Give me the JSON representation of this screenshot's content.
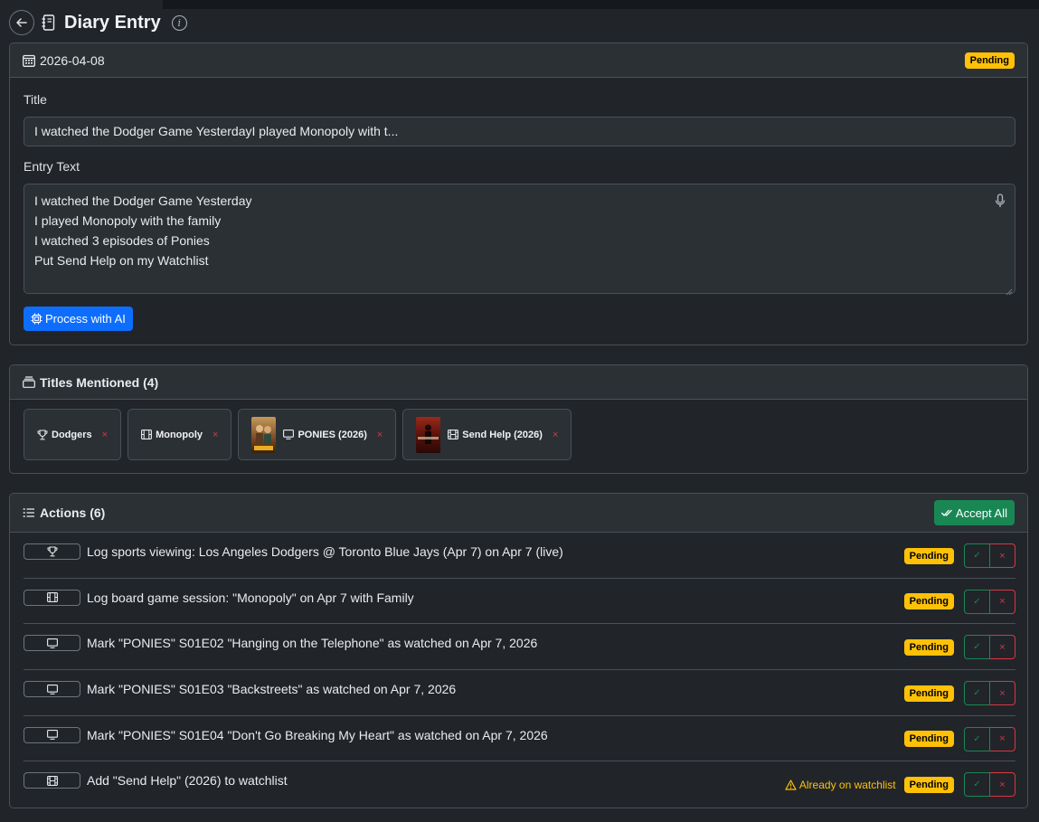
{
  "header": {
    "title": "Diary Entry",
    "back_icon": "arrow-left-icon",
    "journal_icon": "journal-icon",
    "info_icon": "info-icon"
  },
  "diary": {
    "date": "2026-04-08",
    "status": "Pending",
    "title_label": "Title",
    "title_value": "I watched the Dodger Game YesterdayI played Monopoly with t...",
    "entry_label": "Entry Text",
    "entry_lines": [
      "I watched the Dodger Game Yesterday",
      "I played Monopoly with the family",
      "I watched 3 episodes of Ponies",
      "Put Send Help on my Watchlist"
    ],
    "process_label": "Process with AI"
  },
  "titles": {
    "heading": "Titles Mentioned (4)",
    "chips": [
      {
        "label": "Dodgers",
        "icon": "trophy-icon",
        "remove": "×"
      },
      {
        "label": "Monopoly",
        "icon": "board-game-icon",
        "remove": "×"
      },
      {
        "label": "PONIES (2026)",
        "icon": "tv-icon",
        "remove": "×",
        "poster_color": "#8a5a2a"
      },
      {
        "label": "Send Help (2026)",
        "icon": "film-icon",
        "remove": "×",
        "poster_color": "#7a1a14"
      }
    ]
  },
  "actions": {
    "heading": "Actions (6)",
    "accept_all_label": "Accept All",
    "items": [
      {
        "icon": "trophy-icon",
        "text": "Log sports viewing: Los Angeles Dodgers @ Toronto Blue Jays (Apr 7) on Apr 7 (live)",
        "status": "Pending",
        "warning": ""
      },
      {
        "icon": "board-game-icon",
        "text": "Log board game session: \"Monopoly\" on Apr 7 with Family",
        "status": "Pending",
        "warning": ""
      },
      {
        "icon": "tv-icon",
        "text": "Mark \"PONIES\" S01E02 \"Hanging on the Telephone\" as watched on Apr 7, 2026",
        "status": "Pending",
        "warning": ""
      },
      {
        "icon": "tv-icon",
        "text": "Mark \"PONIES\" S01E03 \"Backstreets\" as watched on Apr 7, 2026",
        "status": "Pending",
        "warning": ""
      },
      {
        "icon": "tv-icon",
        "text": "Mark \"PONIES\" S01E04 \"Don't Go Breaking My Heart\" as watched on Apr 7, 2026",
        "status": "Pending",
        "warning": ""
      },
      {
        "icon": "film-icon",
        "text": "Add \"Send Help\" (2026) to watchlist",
        "status": "Pending",
        "warning": "Already on watchlist"
      }
    ],
    "accept_glyph": "✓",
    "reject_glyph": "×"
  },
  "colors": {
    "accent_blue": "#0d6efd",
    "success_green": "#198754",
    "danger_red": "#dc3545",
    "warning_yellow": "#ffc107"
  }
}
